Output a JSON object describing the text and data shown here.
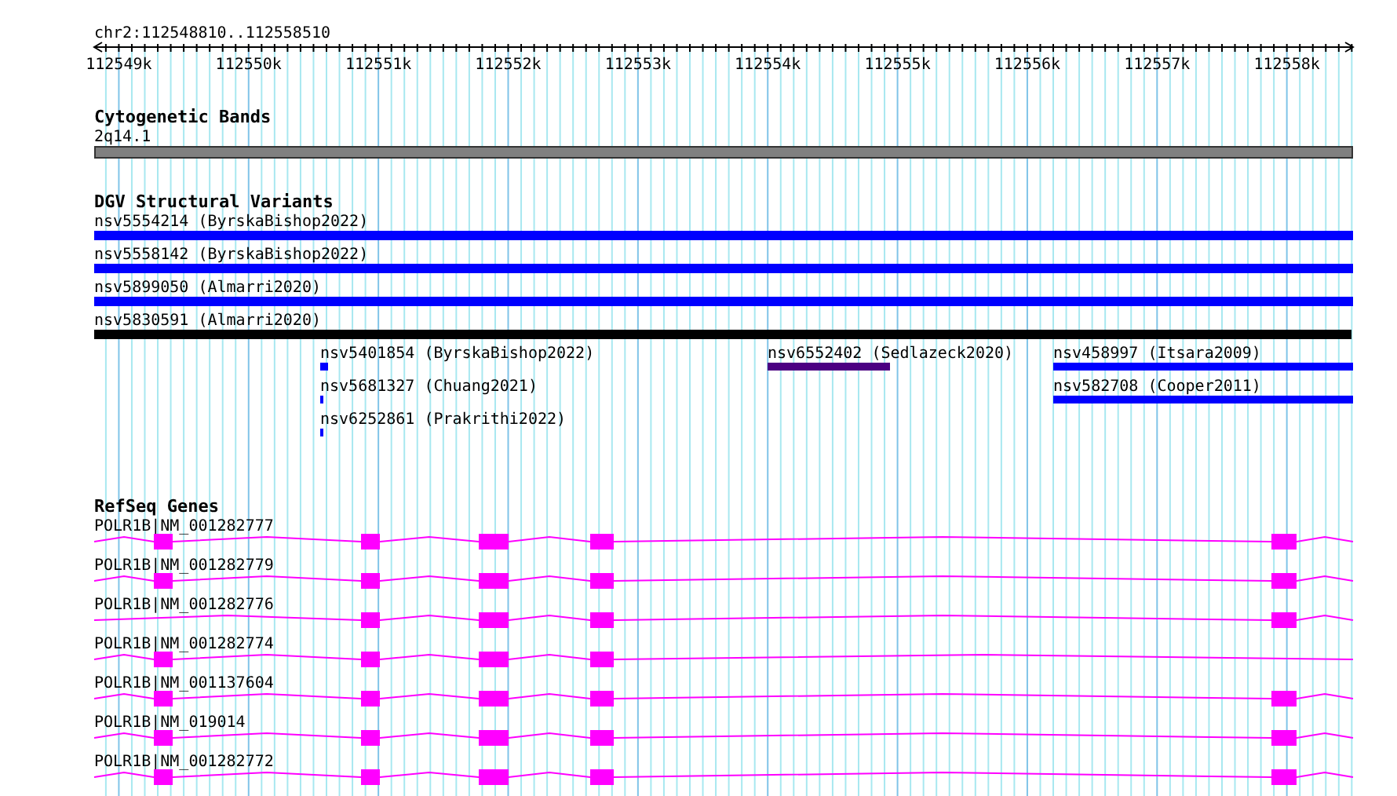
{
  "location": "chr2:112548810..112558510",
  "ruler": {
    "ticks": [
      "112549k",
      "112550k",
      "112551k",
      "112552k",
      "112553k",
      "112554k",
      "112555k",
      "112556k",
      "112557k",
      "112558k"
    ]
  },
  "tracks": [
    {
      "kind": "bands",
      "title": "Cytogenetic Bands",
      "features": [
        {
          "label": "2q14.1"
        }
      ]
    },
    {
      "kind": "variants",
      "title": "DGV Structural Variants",
      "features": [
        {
          "label": "nsv5554214 (ByrskaBishop2022)",
          "color": "#0000ff"
        },
        {
          "label": "nsv5558142 (ByrskaBishop2022)",
          "color": "#0000ff"
        },
        {
          "label": "nsv5899050 (Almarri2020)",
          "color": "#0000ff"
        },
        {
          "label": "nsv5830591 (Almarri2020)",
          "color": "#000000"
        },
        {
          "label": "nsv5401854 (ByrskaBishop2022)",
          "color": "#0000ff"
        },
        {
          "label": "nsv6552402 (Sedlazeck2020)",
          "color": "#4b0082"
        },
        {
          "label": "nsv458997 (Itsara2009)",
          "color": "#0000ff"
        },
        {
          "label": "nsv5681327 (Chuang2021)",
          "color": "#0000ff"
        },
        {
          "label": "nsv582708 (Cooper2011)",
          "color": "#0000ff"
        },
        {
          "label": "nsv6252861 (Prakrithi2022)",
          "color": "#0000ff"
        }
      ]
    },
    {
      "kind": "genes",
      "title": "RefSeq Genes",
      "features": [
        {
          "label": "POLR1B|NM_001282777"
        },
        {
          "label": "POLR1B|NM_001282779"
        },
        {
          "label": "POLR1B|NM_001282776"
        },
        {
          "label": "POLR1B|NM_001282774"
        },
        {
          "label": "POLR1B|NM_001137604"
        },
        {
          "label": "POLR1B|NM_019014"
        },
        {
          "label": "POLR1B|NM_001282772"
        }
      ]
    }
  ]
}
